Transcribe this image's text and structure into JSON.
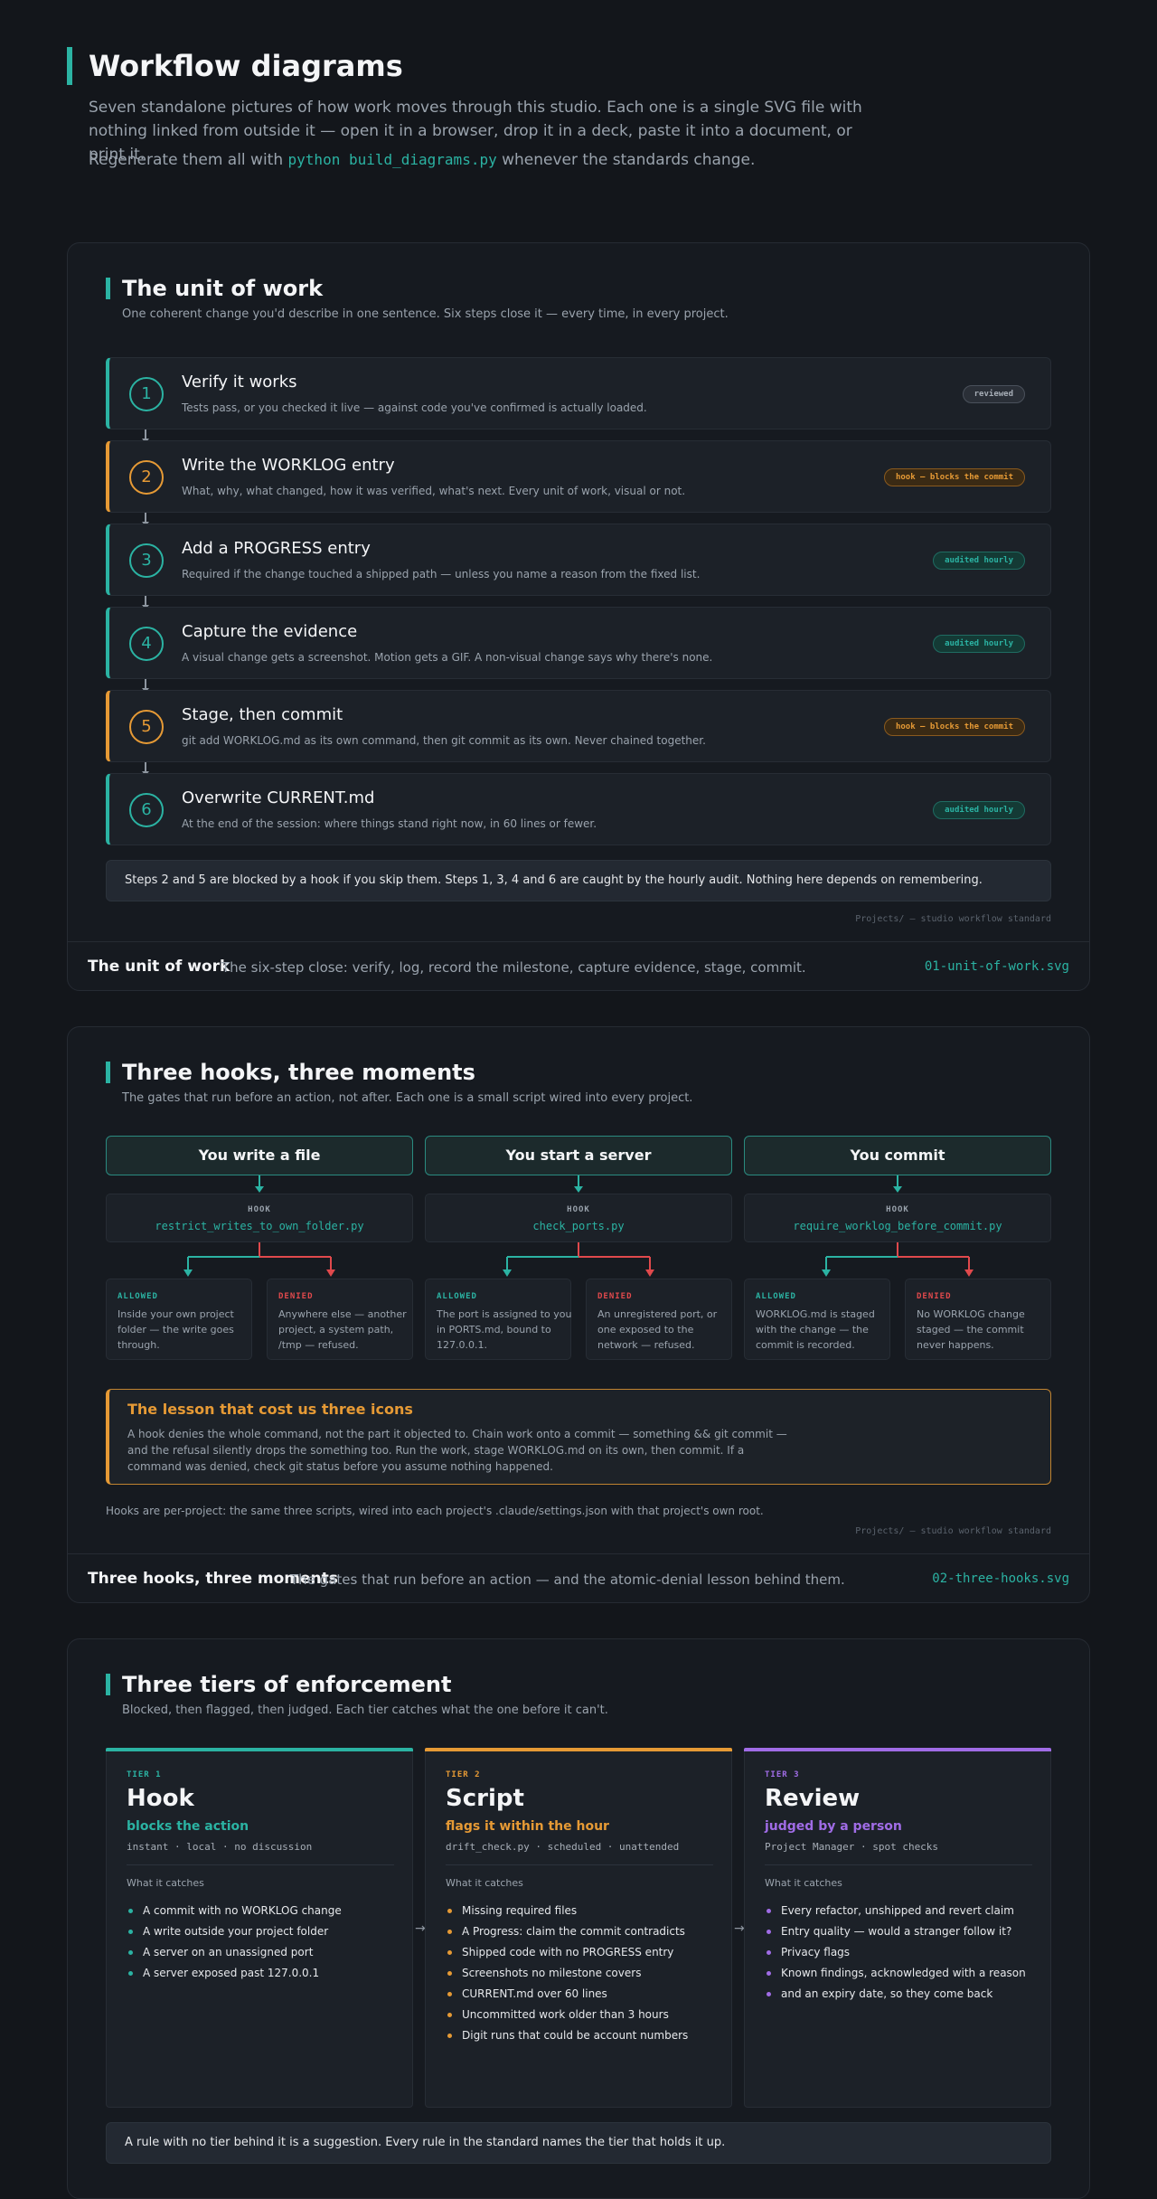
{
  "header": {
    "title": "Workflow diagrams",
    "intro": "Seven standalone pictures of how work moves through this studio. Each one is a single SVG file with nothing linked from outside it — open it in a browser, drop it in a deck, paste it into a document, or print it.",
    "regen_prefix": "Regenerate them all with",
    "regen_command": "python build_diagrams.py",
    "regen_suffix": "whenever the standards change."
  },
  "credit": "Projects/ — studio workflow standard",
  "unit_of_work": {
    "title": "The unit of work",
    "subtitle": "One coherent change you'd describe in one sentence. Six steps close it — every time, in every project.",
    "steps": [
      {
        "num": "1",
        "title": "Verify it works",
        "desc": "Tests pass, or you checked it live — against code you've confirmed is actually loaded.",
        "badge": "reviewed"
      },
      {
        "num": "2",
        "title": "Write the WORKLOG entry",
        "desc": "What, why, what changed, how it was verified, what's next. Every unit of work, visual or not.",
        "badge": "hook — blocks the commit"
      },
      {
        "num": "3",
        "title": "Add a PROGRESS entry",
        "desc": "Required if the change touched a shipped path — unless you name a reason from the fixed list.",
        "badge": "audited hourly"
      },
      {
        "num": "4",
        "title": "Capture the evidence",
        "desc": "A visual change gets a screenshot. Motion gets a GIF. A non-visual change says why there's none.",
        "badge": "audited hourly"
      },
      {
        "num": "5",
        "title": "Stage, then commit",
        "desc": "git add WORKLOG.md as its own command, then git commit as its own. Never chained together.",
        "badge": "hook — blocks the commit"
      },
      {
        "num": "6",
        "title": "Overwrite CURRENT.md",
        "desc": "At the end of the session: where things stand right now, in 60 lines or fewer.",
        "badge": "audited hourly"
      }
    ],
    "note": "Steps 2 and 5 are blocked by a hook if you skip them. Steps 1, 3, 4 and 6 are caught by the hourly audit. Nothing here depends on remembering.",
    "footer": {
      "name": "The unit of work",
      "desc": "The six-step close: verify, log, record the milestone, capture evidence, stage, commit.",
      "file": "01-unit-of-work.svg"
    }
  },
  "hooks": {
    "title": "Three hooks, three moments",
    "subtitle": "The gates that run before an action, not after. Each one is a small script wired into every project.",
    "hook_label": "HOOK",
    "allowed_label": "ALLOWED",
    "denied_label": "DENIED",
    "columns": [
      {
        "trigger": "You write a file",
        "script": "restrict_writes_to_own_folder.py",
        "allowed": "Inside your own project folder — the write goes through.",
        "denied": "Anywhere else — another project, a system path, /tmp — refused."
      },
      {
        "trigger": "You start a server",
        "script": "check_ports.py",
        "allowed": "The port is assigned to you in PORTS.md, bound to 127.0.0.1.",
        "denied": "An unregistered port, or one exposed to the network — refused."
      },
      {
        "trigger": "You commit",
        "script": "require_worklog_before_commit.py",
        "allowed": "WORKLOG.md is staged with the change — the commit is recorded.",
        "denied": "No WORKLOG change staged — the commit never happens."
      }
    ],
    "lesson_title": "The lesson that cost us three icons",
    "lesson_text": "A hook denies the whole command, not the part it objected to. Chain work onto a commit — something && git commit — and the refusal silently drops the something too. Run the work, stage WORKLOG.md on its own, then commit. If a command was denied, check git status before you assume nothing happened.",
    "footnote": "Hooks are per-project: the same three scripts, wired into each project's .claude/settings.json with that project's own root.",
    "footer": {
      "name": "Three hooks, three moments",
      "desc": "The gates that run before an action — and the atomic-denial lesson behind them.",
      "file": "02-three-hooks.svg"
    }
  },
  "tiers": {
    "title": "Three tiers of enforcement",
    "subtitle": "Blocked, then flagged, then judged. Each tier catches what the one before it can't.",
    "what_it_catches": "What it catches",
    "items": [
      {
        "label": "TIER 1",
        "name": "Hook",
        "tagline": "blocks the action",
        "meta": "instant · local · no discussion",
        "color": "#2bb3a3",
        "catches": [
          "A commit with no WORKLOG change",
          "A write outside your project folder",
          "A server on an unassigned port",
          "A server exposed past 127.0.0.1"
        ]
      },
      {
        "label": "TIER 2",
        "name": "Script",
        "tagline": "flags it within the hour",
        "meta": "drift_check.py · scheduled · unattended",
        "color": "#e69a35",
        "catches": [
          "Missing required files",
          "A Progress: claim the commit contradicts",
          "Shipped code with no PROGRESS entry",
          "Screenshots no milestone covers",
          "CURRENT.md over 60 lines",
          "Uncommitted work older than 3 hours",
          "Digit runs that could be account numbers"
        ]
      },
      {
        "label": "TIER 3",
        "name": "Review",
        "tagline": "judged by a person",
        "meta": "Project Manager · spot checks",
        "color": "#a06ce6",
        "catches": [
          "Every refactor, unshipped and revert claim",
          "Entry quality — would a stranger follow it?",
          "Privacy flags",
          "Known findings, acknowledged with a reason",
          "and an expiry date, so they come back"
        ]
      }
    ],
    "note": "A rule with no tier behind it is a suggestion. Every rule in the standard names the tier that holds it up."
  }
}
